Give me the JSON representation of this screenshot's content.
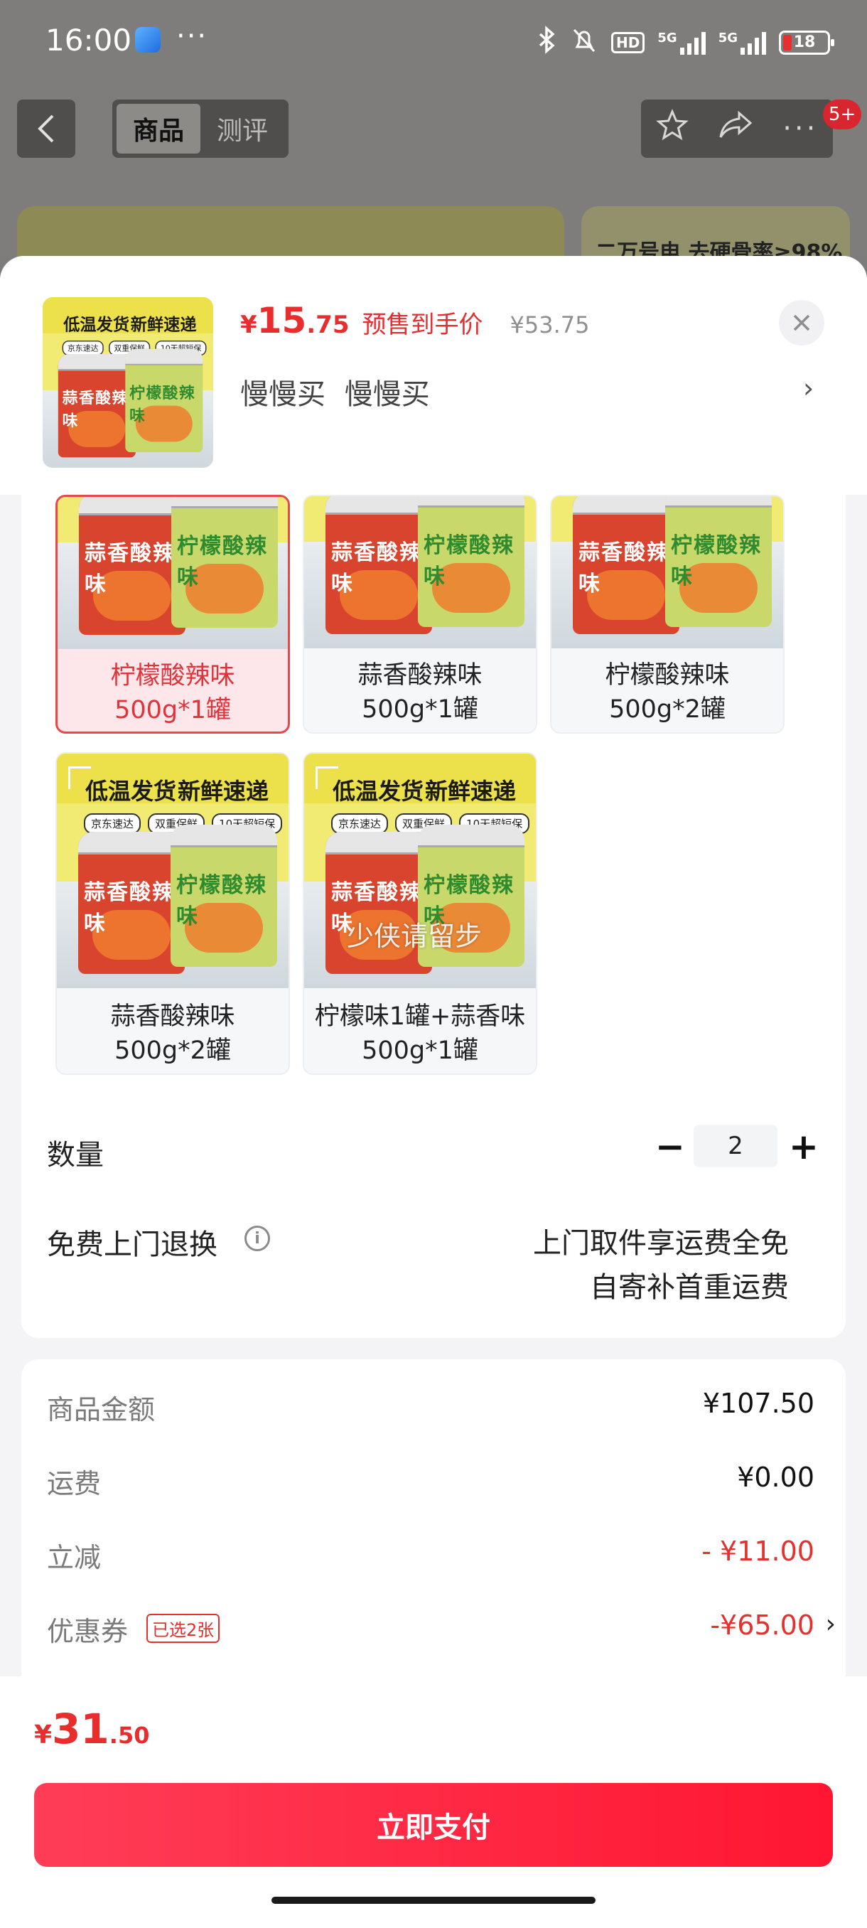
{
  "status_bar": {
    "time": "16:00",
    "dots": "···",
    "hd": "HD",
    "net1": "5G",
    "net2": "5G",
    "battery": "18"
  },
  "top_nav": {
    "back_icon": "chevron-left-icon",
    "tabs": [
      {
        "label": "商品",
        "active": true
      },
      {
        "label": "测评",
        "active": false
      }
    ],
    "actions": [
      "star-icon",
      "share-icon",
      "more-icon"
    ],
    "badge": "5+"
  },
  "background_banner": {
    "right_text": "二万号电 去硬骨率≥98%"
  },
  "sheet": {
    "price_yen": "¥",
    "price_int": "15",
    "price_dec": ".75",
    "price_note": "预售到手价",
    "original_price": "¥53.75",
    "subtitle": "慢慢买 慢慢买",
    "product_image": {
      "banner_left": "低温发货",
      "banner_right": "新鲜速递",
      "tags": [
        "京东速达",
        "双重保鲜",
        "10天超短保"
      ],
      "jar_red": "蒜香酸辣味",
      "jar_green": "柠檬酸辣味"
    }
  },
  "variants": [
    {
      "line1": "柠檬酸辣味",
      "line2": "500g*1罐",
      "selected": true
    },
    {
      "line1": "蒜香酸辣味",
      "line2": "500g*1罐",
      "selected": false
    },
    {
      "line1": "柠檬酸辣味",
      "line2": "500g*2罐",
      "selected": false
    },
    {
      "line1": "蒜香酸辣味",
      "line2": "500g*2罐",
      "selected": false
    },
    {
      "line1": "柠檬味1罐+蒜香味",
      "line2": "500g*1罐",
      "selected": false
    }
  ],
  "watermark": "少侠请留步",
  "quantity": {
    "label": "数量",
    "minus": "−",
    "value": "2",
    "plus": "+"
  },
  "free_return": {
    "label": "免费上门退换",
    "info_icon": "i",
    "line1": "上门取件享运费全免",
    "line2": "自寄补首重运费"
  },
  "summary": {
    "goods_label": "商品金额",
    "goods_value": "¥107.50",
    "shipping_label": "运费",
    "shipping_value": "¥0.00",
    "discount_label": "立减",
    "discount_value": "- ¥11.00",
    "coupon_label": "优惠券",
    "coupon_tag": "已选2张",
    "coupon_value": "-¥65.00",
    "coupon_chevron": "›"
  },
  "bottom": {
    "total_yen": "¥",
    "total_int": "31",
    "total_dec": ".50",
    "pay_label": "立即支付"
  }
}
